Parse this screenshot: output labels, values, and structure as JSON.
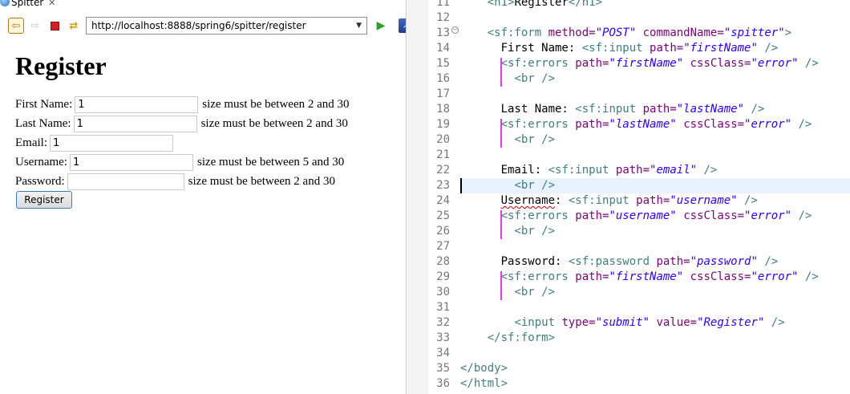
{
  "browser": {
    "tab_title": "Spitter",
    "url": "http://localhost:8888/spring6/spitter/register",
    "page": {
      "heading": "Register",
      "fields": [
        {
          "label": "First Name:",
          "value": "1",
          "error": "size must be between 2 and 30"
        },
        {
          "label": "Last Name:",
          "value": "1",
          "error": "size must be between 2 and 30"
        },
        {
          "label": "Email:",
          "value": "1",
          "error": ""
        },
        {
          "label": "Username:",
          "value": "1",
          "error": "size must be between 5 and 30"
        },
        {
          "label": "Password:",
          "value": "",
          "error": "size must be between 2 and 30"
        }
      ],
      "submit_label": "Register"
    }
  },
  "editor": {
    "current_line": 23,
    "lines": [
      {
        "num": "11",
        "indent": "    ",
        "tokens": [
          {
            "k": "tag",
            "t": "<h1>"
          },
          {
            "k": "txt",
            "t": "Register"
          },
          {
            "k": "tag",
            "t": "</h1>"
          }
        ]
      },
      {
        "num": "12",
        "indent": "",
        "tokens": []
      },
      {
        "num": "13",
        "indent": "    ",
        "tokens": [
          {
            "k": "tag",
            "t": "<sf:form "
          },
          {
            "k": "attr",
            "t": "method="
          },
          {
            "k": "val",
            "t": "\"POST\""
          },
          {
            "k": "tag",
            "t": " "
          },
          {
            "k": "attr",
            "t": "commandName="
          },
          {
            "k": "val",
            "t": "\"spitter\""
          },
          {
            "k": "tag",
            "t": ">"
          }
        ]
      },
      {
        "num": "14",
        "indent": "      ",
        "tokens": [
          {
            "k": "txt",
            "t": "First Name: "
          },
          {
            "k": "tag",
            "t": "<sf:input "
          },
          {
            "k": "attr",
            "t": "path="
          },
          {
            "k": "val",
            "t": "\"firstName\""
          },
          {
            "k": "tag",
            "t": " />"
          }
        ]
      },
      {
        "num": "15",
        "indent": "      ",
        "tokens": [
          {
            "k": "tag",
            "t": "<sf:errors "
          },
          {
            "k": "attr",
            "t": "path="
          },
          {
            "k": "val",
            "t": "\"firstName\""
          },
          {
            "k": "tag",
            "t": " "
          },
          {
            "k": "attr",
            "t": "cssClass="
          },
          {
            "k": "val",
            "t": "\"error\""
          },
          {
            "k": "tag",
            "t": " />"
          }
        ]
      },
      {
        "num": "16",
        "indent": "        ",
        "tokens": [
          {
            "k": "tag",
            "t": "<br />"
          }
        ]
      },
      {
        "num": "17",
        "indent": "",
        "tokens": []
      },
      {
        "num": "18",
        "indent": "      ",
        "tokens": [
          {
            "k": "txt",
            "t": "Last Name: "
          },
          {
            "k": "tag",
            "t": "<sf:input "
          },
          {
            "k": "attr",
            "t": "path="
          },
          {
            "k": "val",
            "t": "\"lastName\""
          },
          {
            "k": "tag",
            "t": " />"
          }
        ]
      },
      {
        "num": "19",
        "indent": "      ",
        "tokens": [
          {
            "k": "tag",
            "t": "<sf:errors "
          },
          {
            "k": "attr",
            "t": "path="
          },
          {
            "k": "val",
            "t": "\"lastName\""
          },
          {
            "k": "tag",
            "t": " "
          },
          {
            "k": "attr",
            "t": "cssClass="
          },
          {
            "k": "val",
            "t": "\"error\""
          },
          {
            "k": "tag",
            "t": " />"
          }
        ]
      },
      {
        "num": "20",
        "indent": "        ",
        "tokens": [
          {
            "k": "tag",
            "t": "<br />"
          }
        ]
      },
      {
        "num": "21",
        "indent": "",
        "tokens": []
      },
      {
        "num": "22",
        "indent": "      ",
        "tokens": [
          {
            "k": "txt",
            "t": "Email: "
          },
          {
            "k": "tag",
            "t": "<sf:input "
          },
          {
            "k": "attr",
            "t": "path="
          },
          {
            "k": "val",
            "t": "\"email\""
          },
          {
            "k": "tag",
            "t": " />"
          }
        ]
      },
      {
        "num": "23",
        "indent": "        ",
        "tokens": [
          {
            "k": "tag",
            "t": "<br />"
          }
        ]
      },
      {
        "num": "24",
        "indent": "      ",
        "tokens": [
          {
            "k": "txt squiggle",
            "t": "Username"
          },
          {
            "k": "txt",
            "t": ": "
          },
          {
            "k": "tag",
            "t": "<sf:input "
          },
          {
            "k": "attr",
            "t": "path="
          },
          {
            "k": "val",
            "t": "\"username\""
          },
          {
            "k": "tag",
            "t": " />"
          }
        ]
      },
      {
        "num": "25",
        "indent": "      ",
        "tokens": [
          {
            "k": "tag",
            "t": "<sf:errors "
          },
          {
            "k": "attr",
            "t": "path="
          },
          {
            "k": "val",
            "t": "\"username\""
          },
          {
            "k": "tag",
            "t": " "
          },
          {
            "k": "attr",
            "t": "cssClass="
          },
          {
            "k": "val",
            "t": "\"error\""
          },
          {
            "k": "tag",
            "t": " />"
          }
        ]
      },
      {
        "num": "26",
        "indent": "        ",
        "tokens": [
          {
            "k": "tag",
            "t": "<br />"
          }
        ]
      },
      {
        "num": "27",
        "indent": "",
        "tokens": []
      },
      {
        "num": "28",
        "indent": "      ",
        "tokens": [
          {
            "k": "txt",
            "t": "Password: "
          },
          {
            "k": "tag",
            "t": "<sf:password "
          },
          {
            "k": "attr",
            "t": "path="
          },
          {
            "k": "val",
            "t": "\"password\""
          },
          {
            "k": "tag",
            "t": " />"
          }
        ]
      },
      {
        "num": "29",
        "indent": "      ",
        "tokens": [
          {
            "k": "tag",
            "t": "<sf:errors "
          },
          {
            "k": "attr",
            "t": "path="
          },
          {
            "k": "val",
            "t": "\"firstName\""
          },
          {
            "k": "tag",
            "t": " "
          },
          {
            "k": "attr",
            "t": "cssClass="
          },
          {
            "k": "val",
            "t": "\"error\""
          },
          {
            "k": "tag",
            "t": " />"
          }
        ]
      },
      {
        "num": "30",
        "indent": "        ",
        "tokens": [
          {
            "k": "tag",
            "t": "<br />"
          }
        ]
      },
      {
        "num": "31",
        "indent": "",
        "tokens": []
      },
      {
        "num": "32",
        "indent": "        ",
        "tokens": [
          {
            "k": "tag",
            "t": "<input "
          },
          {
            "k": "attr",
            "t": "type="
          },
          {
            "k": "val",
            "t": "\"submit\""
          },
          {
            "k": "tag",
            "t": " "
          },
          {
            "k": "attr",
            "t": "value="
          },
          {
            "k": "val",
            "t": "\"Register\""
          },
          {
            "k": "tag",
            "t": " />"
          }
        ]
      },
      {
        "num": "33",
        "indent": "    ",
        "tokens": [
          {
            "k": "tag",
            "t": "</sf:form>"
          }
        ]
      },
      {
        "num": "34",
        "indent": "",
        "tokens": []
      },
      {
        "num": "35",
        "indent": "",
        "tokens": [
          {
            "k": "tag",
            "t": "</body>"
          }
        ]
      },
      {
        "num": "36",
        "indent": "",
        "tokens": [
          {
            "k": "tag",
            "t": "</html>"
          }
        ]
      }
    ]
  }
}
